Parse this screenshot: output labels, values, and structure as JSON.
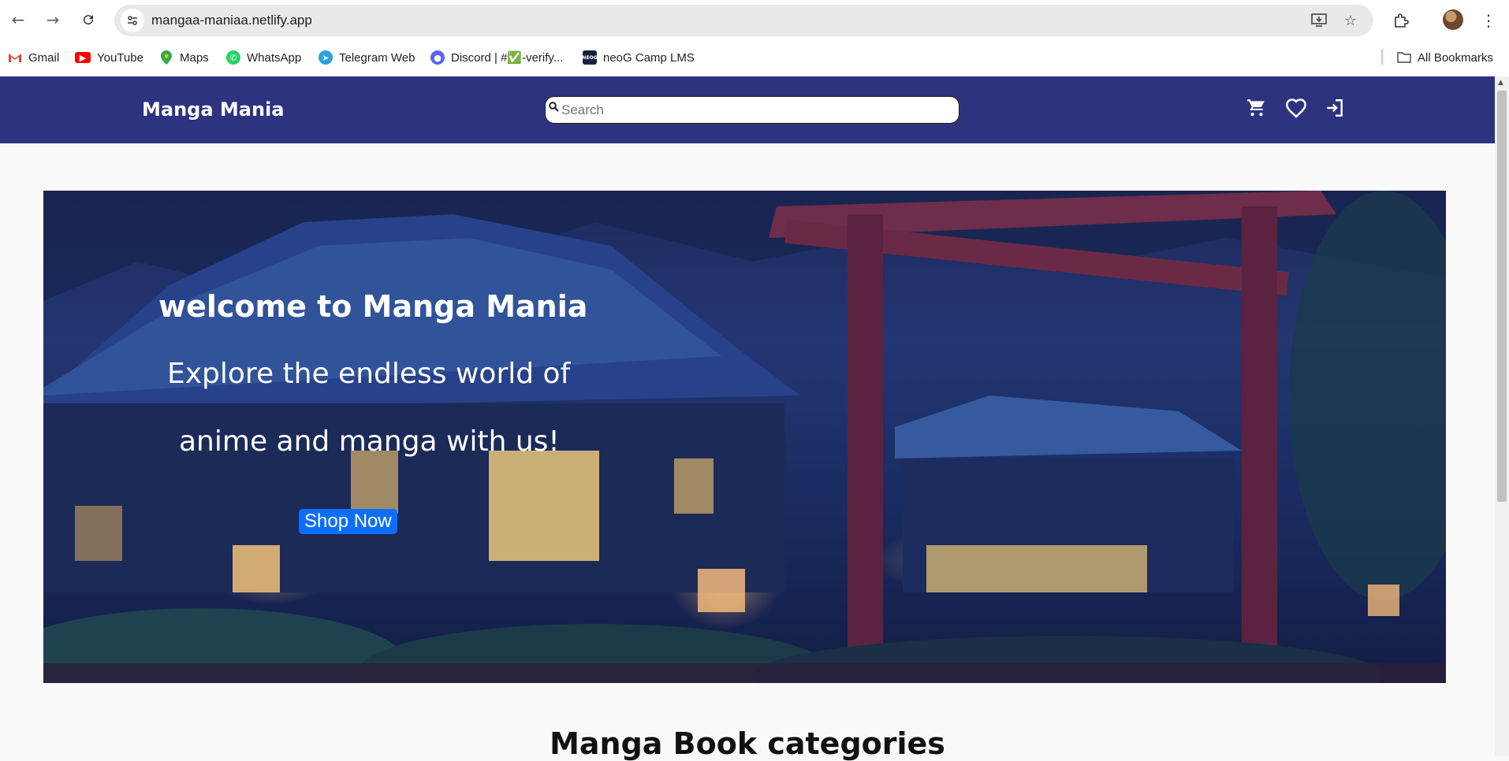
{
  "browser": {
    "url": "mangaa-maniaa.netlify.app",
    "bookmarks": [
      {
        "label": "Gmail",
        "icon": "gmail-icon",
        "color": "#ea4335"
      },
      {
        "label": "YouTube",
        "icon": "youtube-icon",
        "color": "#ff0000"
      },
      {
        "label": "Maps",
        "icon": "maps-icon",
        "color": "#34a853"
      },
      {
        "label": "WhatsApp",
        "icon": "whatsapp-icon",
        "color": "#25d366"
      },
      {
        "label": "Telegram Web",
        "icon": "telegram-icon",
        "color": "#2aa3df"
      },
      {
        "label": "Discord | #✅-verify...",
        "icon": "discord-icon",
        "color": "#5865f2"
      },
      {
        "label": "neoG Camp LMS",
        "icon": "neog-icon",
        "color": "#1a1f3c"
      }
    ],
    "all_bookmarks": "All Bookmarks"
  },
  "site": {
    "brand": "Manga Mania",
    "search_placeholder": "Search",
    "nav_color": "#2e3380"
  },
  "hero": {
    "title": "welcome to Manga Mania",
    "line1": "Explore the endless world of",
    "line2": "anime and manga with us!",
    "cta": "Shop Now",
    "cta_color": "#0d6efd"
  },
  "categories": {
    "title": "Manga Book categories"
  }
}
